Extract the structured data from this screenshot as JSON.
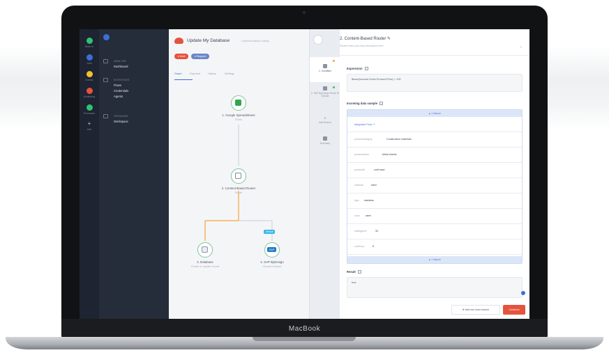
{
  "device": {
    "brand": "MacBook"
  },
  "rail": {
    "items": [
      {
        "label": "Back to",
        "color": "#2ec36e"
      },
      {
        "label": "Jobs",
        "color": "#3b6fd8"
      },
      {
        "label": "Events",
        "color": "#f2c230"
      },
      {
        "label": "Monitoring",
        "color": "#e5533d"
      },
      {
        "label": "Processes",
        "color": "#2ec36e"
      },
      {
        "label": "Add",
        "color": "#7f8899"
      }
    ]
  },
  "nav": {
    "groups": [
      {
        "caption": "ANALYZE",
        "links": [
          "Dashboard"
        ]
      },
      {
        "caption": "INTEGRATE",
        "links": [
          "Flows",
          "Credentials",
          "Agents"
        ]
      },
      {
        "caption": "ORGANIZE",
        "links": [
          "Workspace"
        ]
      }
    ]
  },
  "canvas": {
    "title": "Update My Database",
    "subtitle": "Content-based routing",
    "draft_label": "● Draft",
    "status_label": "● Stopped",
    "tabs": [
      "Graph",
      "Payment",
      "History",
      "Settings"
    ],
    "nodes": {
      "sheets": {
        "title": "1. Google Spreadsheets",
        "sub": "Rows",
        "color": "#2ea84f"
      },
      "router": {
        "title": "2. Content-Based Router",
        "sub": "Route",
        "color": "#7f8899"
      },
      "database": {
        "title": "3. Database",
        "sub": "Create or update record",
        "color": "#8f97a3"
      },
      "sap": {
        "title": "4. SAP ByDesign",
        "sub": "Choose function",
        "color": "#1f79c9",
        "logo_text": "SAP",
        "badge": "Default"
      }
    }
  },
  "steps": [
    {
      "label": "1. Condition",
      "dot": "#f2a53b"
    },
    {
      "label": "2. SAP ByDesign Route ID Default",
      "dot": "#2ec36e"
    },
    {
      "label": "Add Branch",
      "dot": ""
    },
    {
      "label": "Summary",
      "dot": ""
    }
  ],
  "panel": {
    "title": "2. Content-Based Router ✎",
    "description": "Please enter your step description here",
    "expression_label": "Expression",
    "expression_value": "$sum(Account.Order.Product.Price) > 100",
    "sample_label": "Incoming data sample",
    "collapse": "▲ Collapse",
    "integrator_link": "Integrator Flow ↗",
    "fields": [
      {
        "key": "productcategory",
        "value": "Construction materials"
      },
      {
        "key": "productname",
        "value": "Metal sheets"
      },
      {
        "key": "productid",
        "value": "cmlf-mwd"
      },
      {
        "key": "material",
        "value": "steel"
      },
      {
        "key": "type",
        "value": "stainless"
      },
      {
        "key": "color",
        "value": "steel"
      },
      {
        "key": "sellingprice",
        "value": "30"
      },
      {
        "key": "currency",
        "value": "€"
      }
    ],
    "result_label": "Result",
    "result_value": "true",
    "add_branch_button": "⊕ Add one more branch",
    "continue_button": "Continue"
  }
}
